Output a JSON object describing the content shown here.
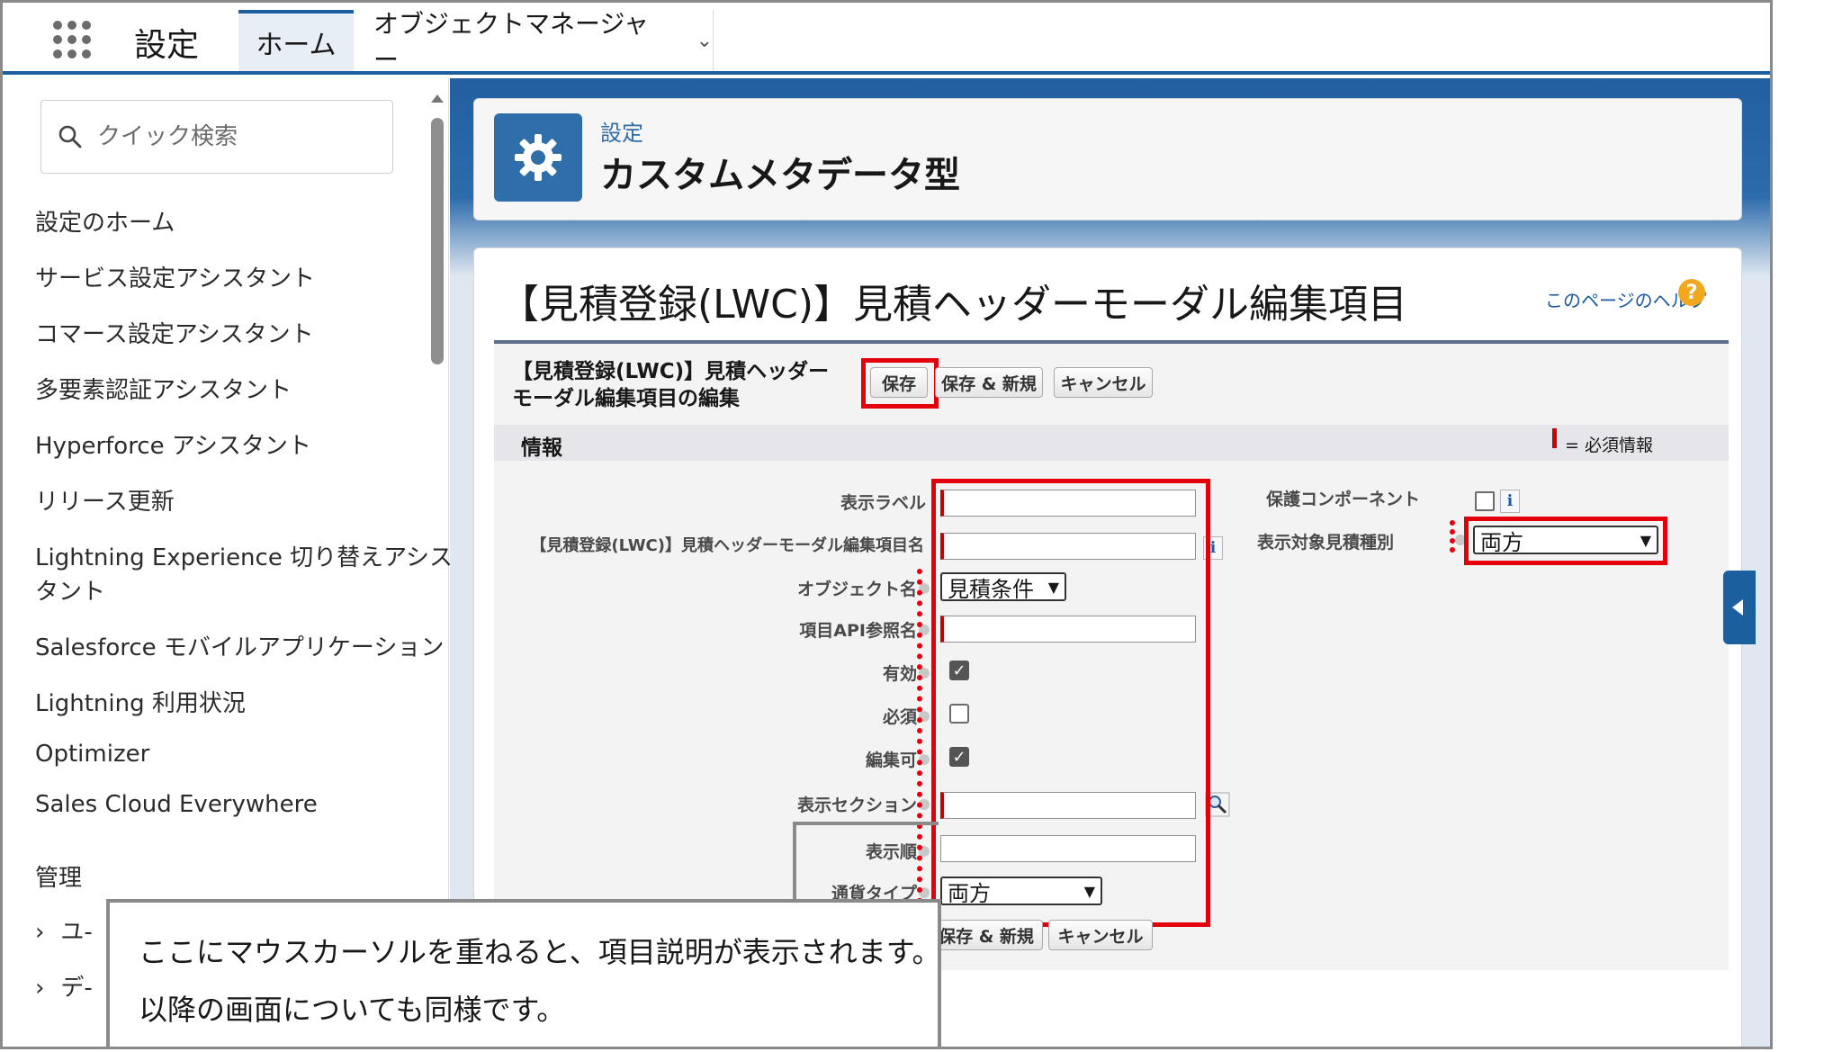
{
  "topbar": {
    "app_title": "設定",
    "tabs": [
      {
        "label": "ホーム"
      },
      {
        "label": "オブジェクトマネージャー"
      }
    ]
  },
  "sidebar": {
    "search_placeholder": "クイック検索",
    "items": [
      {
        "label": "設定のホーム"
      },
      {
        "label": "サービス設定アシスタント"
      },
      {
        "label": "コマース設定アシスタント"
      },
      {
        "label": "多要素認証アシスタント"
      },
      {
        "label": "Hyperforce アシスタント"
      },
      {
        "label": "リリース更新"
      },
      {
        "label": "Lightning Experience 切り替えアシス"
      },
      {
        "label": "タント"
      },
      {
        "label": "Salesforce モバイルアプリケーション"
      },
      {
        "label": "Lightning 利用状況"
      },
      {
        "label": "Optimizer"
      },
      {
        "label": "Sales Cloud Everywhere"
      }
    ],
    "section_label": "管理",
    "sub_items": [
      {
        "label": "ユ-"
      },
      {
        "label": "デ-"
      }
    ]
  },
  "header": {
    "crumb": "設定",
    "title": "カスタムメタデータ型"
  },
  "page": {
    "heading": "【見積登録(LWC)】見積ヘッダーモーダル編集項目",
    "help_link": "このページのヘルプ",
    "help_icon_glyph": "?"
  },
  "edit": {
    "title_line1": "【見積登録(LWC)】見積ヘッダー",
    "title_line2": "モーダル編集項目の編集",
    "buttons": {
      "save": "保存",
      "save_new": "保存 & 新規",
      "cancel": "キャンセル"
    },
    "section_title": "情報",
    "required_legend": "= 必須情報"
  },
  "fields": {
    "display_label": "表示ラベル",
    "api_name": "【見積登録(LWC)】見積ヘッダーモーダル編集項目名",
    "object_name": "オブジェクト名",
    "object_value": "見積条件",
    "field_api": "項目API参照名",
    "active": "有効",
    "required": "必須",
    "editable": "編集可",
    "section": "表示セクション",
    "order": "表示順",
    "currency_type": "通貨タイプ",
    "currency_value": "両方",
    "protected": "保護コンポーネント",
    "quote_type": "表示対象見積種別",
    "quote_type_value": "両方",
    "info_glyph": "i"
  },
  "callout": {
    "line1": "ここにマウスカーソルを重ねると、項目説明が表示されます。",
    "line2": "以降の画面についても同様です。"
  },
  "colors": {
    "brand": "#1b5f9e",
    "highlight": "#e3000b",
    "help": "#f0a81e"
  }
}
